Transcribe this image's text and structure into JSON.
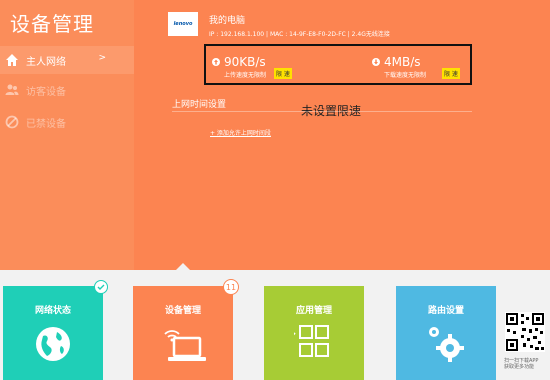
{
  "sidebar": {
    "title": "设备管理",
    "items": [
      {
        "label": "主人网络",
        "arrow": ">",
        "icon": "home-icon"
      },
      {
        "label": "访客设备",
        "icon": "users-icon"
      },
      {
        "label": "已禁设备",
        "icon": "block-icon"
      }
    ]
  },
  "device": {
    "logo_text": "lenovo",
    "name": "我的电脑",
    "info": "IP : 192.168.1.100 | MAC : 14-9F-E8-F0-2D-FC | 2.4G无线连接"
  },
  "speed": {
    "upload_value": "90KB/s",
    "upload_sub": "上传速度无限制",
    "upload_btn": "限 速",
    "download_value": "4MB/s",
    "download_sub": "下载速度无限制",
    "download_btn": "限 速"
  },
  "online_time": {
    "title": "上网时间设置",
    "status": "未设置限速",
    "add_link": "+ 添加允许上网时间段"
  },
  "tiles": [
    {
      "label": "网络状态",
      "color": "#1fcfb7",
      "icon": "globe-icon"
    },
    {
      "label": "设备管理",
      "color": "#fc8451",
      "icon": "laptop-wifi-icon",
      "badge": "11"
    },
    {
      "label": "应用管理",
      "color": "#a7cc35",
      "icon": "apps-grid-icon"
    },
    {
      "label": "路由设置",
      "color": "#4fb9e2",
      "icon": "gears-icon"
    }
  ],
  "qr": {
    "caption_line1": "扫一扫下载APP",
    "caption_line2": "获取更多功能"
  },
  "colors": {
    "sidebar_bg": "#fb8d5a",
    "main_bg": "#fc8451",
    "highlight_yellow": "#ffe100"
  }
}
